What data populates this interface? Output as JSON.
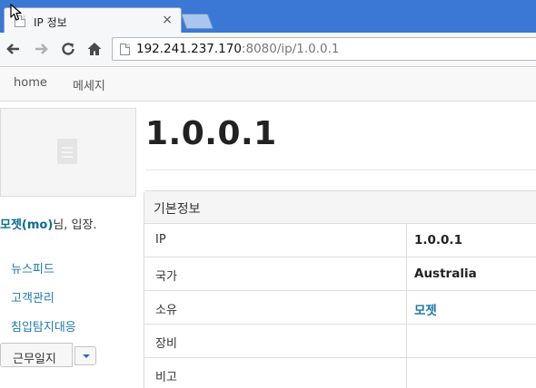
{
  "browser": {
    "tab_title": "IP 정보",
    "tab_close": "×",
    "url_host": "192.241.237.170",
    "url_rest": ":8080/ip/1.0.0.1"
  },
  "navbar": {
    "items": [
      {
        "label": "home"
      },
      {
        "label": "메세지"
      }
    ]
  },
  "sidebar": {
    "greeting_name": "모젯(mo)",
    "greeting_suffix": "님, 입장.",
    "links": [
      {
        "label": "뉴스피드"
      },
      {
        "label": "고객관리"
      },
      {
        "label": "침입탐지대응"
      }
    ],
    "worklog_button": "근무일지"
  },
  "main": {
    "heading": "1.0.0.1",
    "panel_title": "기본정보",
    "rows": [
      {
        "label": "IP",
        "value": "1.0.0.1"
      },
      {
        "label": "국가",
        "value": "Australia"
      },
      {
        "label": "소유",
        "value": "모젯"
      },
      {
        "label": "장비",
        "value": ""
      },
      {
        "label": "비고",
        "value": ""
      }
    ]
  },
  "colors": {
    "tabstrip": "#3b78d6",
    "link": "#1e7aa8",
    "greeting_name": "#0b6b93"
  },
  "icons": [
    "document-icon",
    "close-icon",
    "back-arrow-icon",
    "forward-arrow-icon",
    "reload-icon",
    "home-icon",
    "page-icon",
    "photo-placeholder-icon",
    "caret-down-icon",
    "mouse-cursor-icon"
  ]
}
